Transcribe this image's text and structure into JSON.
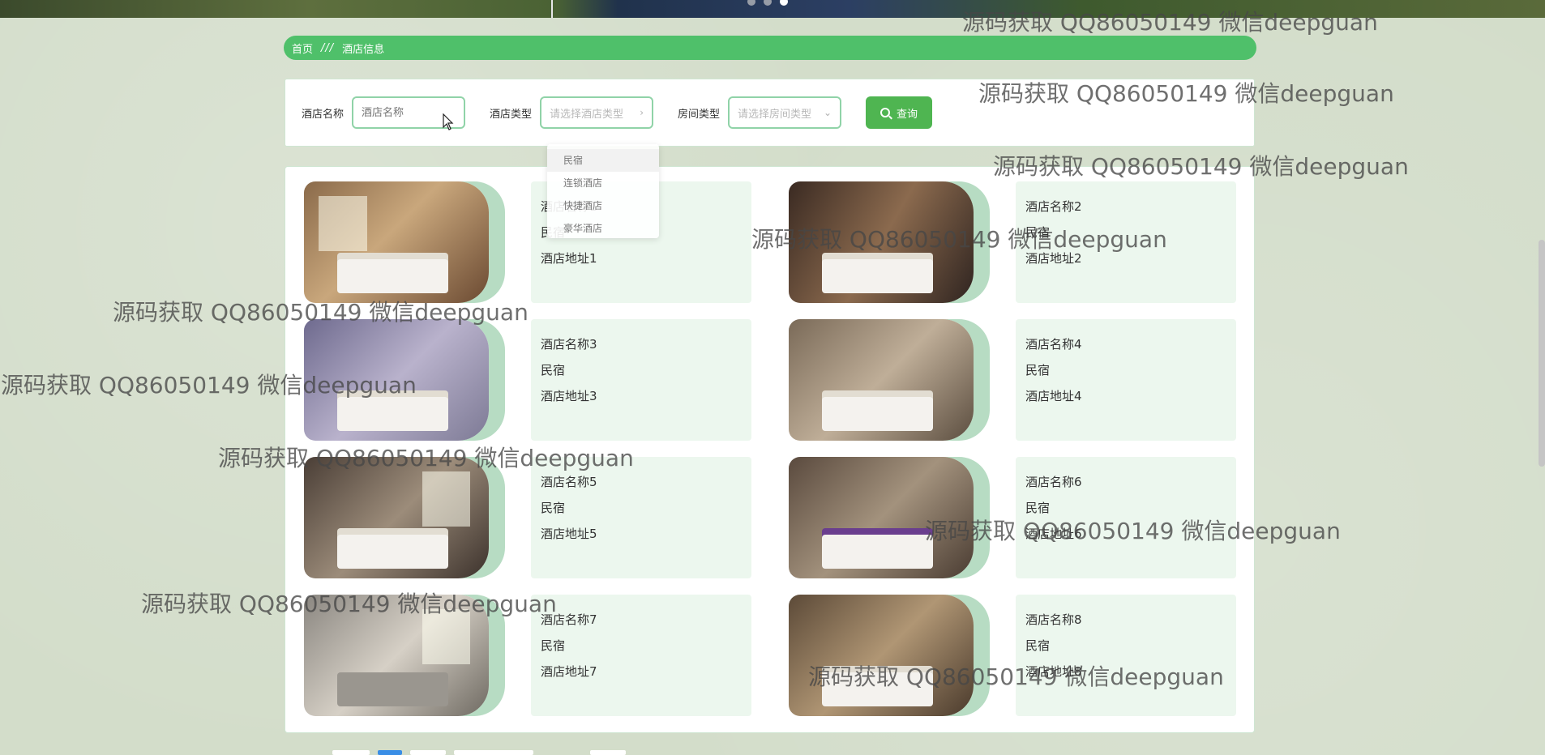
{
  "breadcrumb": {
    "home": "首页",
    "separator": "///",
    "current": "酒店信息"
  },
  "search": {
    "hotel_name_label": "酒店名称",
    "hotel_name_placeholder": "酒店名称",
    "hotel_type_label": "酒店类型",
    "hotel_type_placeholder": "请选择酒店类型",
    "room_type_label": "房间类型",
    "room_type_placeholder": "请选择房间类型",
    "query_label": "查询"
  },
  "dropdown": {
    "options": [
      "民宿",
      "连锁酒店",
      "快捷酒店",
      "豪华酒店"
    ]
  },
  "hotels": [
    {
      "name": "酒店名称1",
      "type": "民宿",
      "address": "酒店地址1"
    },
    {
      "name": "酒店名称2",
      "type": "民宿",
      "address": "酒店地址2"
    },
    {
      "name": "酒店名称3",
      "type": "民宿",
      "address": "酒店地址3"
    },
    {
      "name": "酒店名称4",
      "type": "民宿",
      "address": "酒店地址4"
    },
    {
      "name": "酒店名称5",
      "type": "民宿",
      "address": "酒店地址5"
    },
    {
      "name": "酒店名称6",
      "type": "民宿",
      "address": "酒店地址6"
    },
    {
      "name": "酒店名称7",
      "type": "民宿",
      "address": "酒店地址7"
    },
    {
      "name": "酒店名称8",
      "type": "民宿",
      "address": "酒店地址8"
    }
  ],
  "watermark": "源码获取 QQ86050149 微信deepguan",
  "colors": {
    "accent": "#4fc06a",
    "button": "#4fb551",
    "card_bg": "#ecf7ee",
    "photo_shadow": "#b7dcc3"
  }
}
